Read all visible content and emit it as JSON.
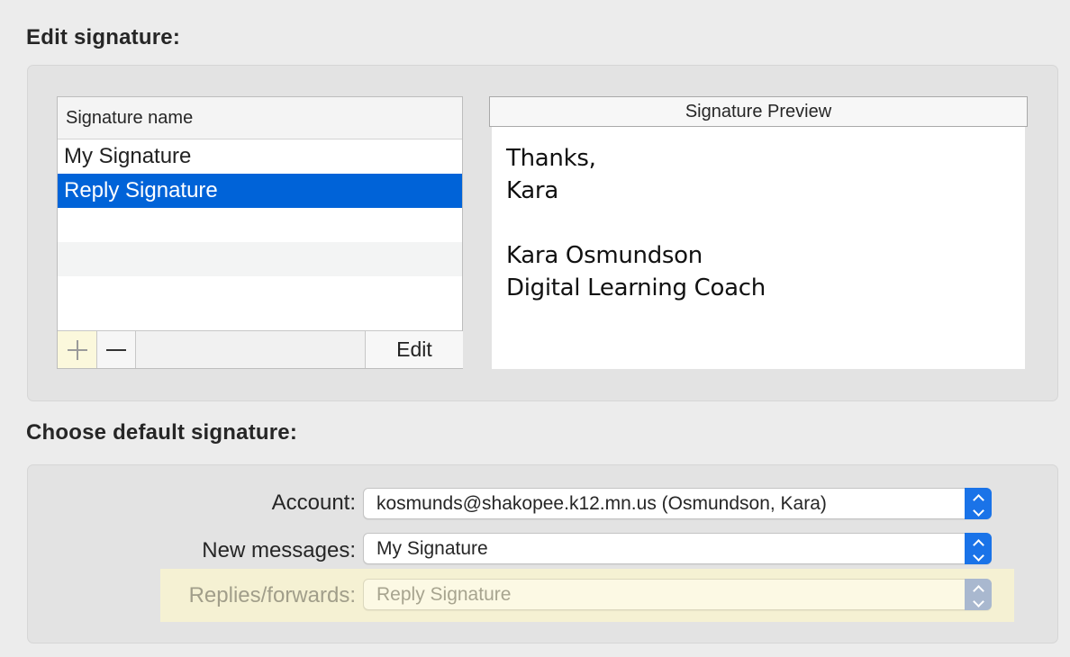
{
  "edit_section": {
    "title": "Edit signature:",
    "list_header": "Signature name",
    "signatures": [
      "My Signature",
      "Reply Signature"
    ],
    "selected_index": 1,
    "add_icon": "plus-icon",
    "remove_icon": "minus-icon",
    "edit_label": "Edit"
  },
  "preview": {
    "header": "Signature Preview",
    "lines": [
      "Thanks,",
      "Kara",
      "",
      "Kara Osmundson",
      "Digital Learning Coach"
    ]
  },
  "default_section": {
    "title": "Choose default signature:",
    "account_label": "Account:",
    "account_value": "kosmunds@shakopee.k12.mn.us (Osmundson, Kara)",
    "new_messages_label": "New messages:",
    "new_messages_value": "My Signature",
    "replies_label": "Replies/forwards:",
    "replies_value": "Reply Signature"
  },
  "colors": {
    "selection": "#0063d8",
    "stepper": "#1a73e8",
    "highlight": "#f5f1d3"
  }
}
